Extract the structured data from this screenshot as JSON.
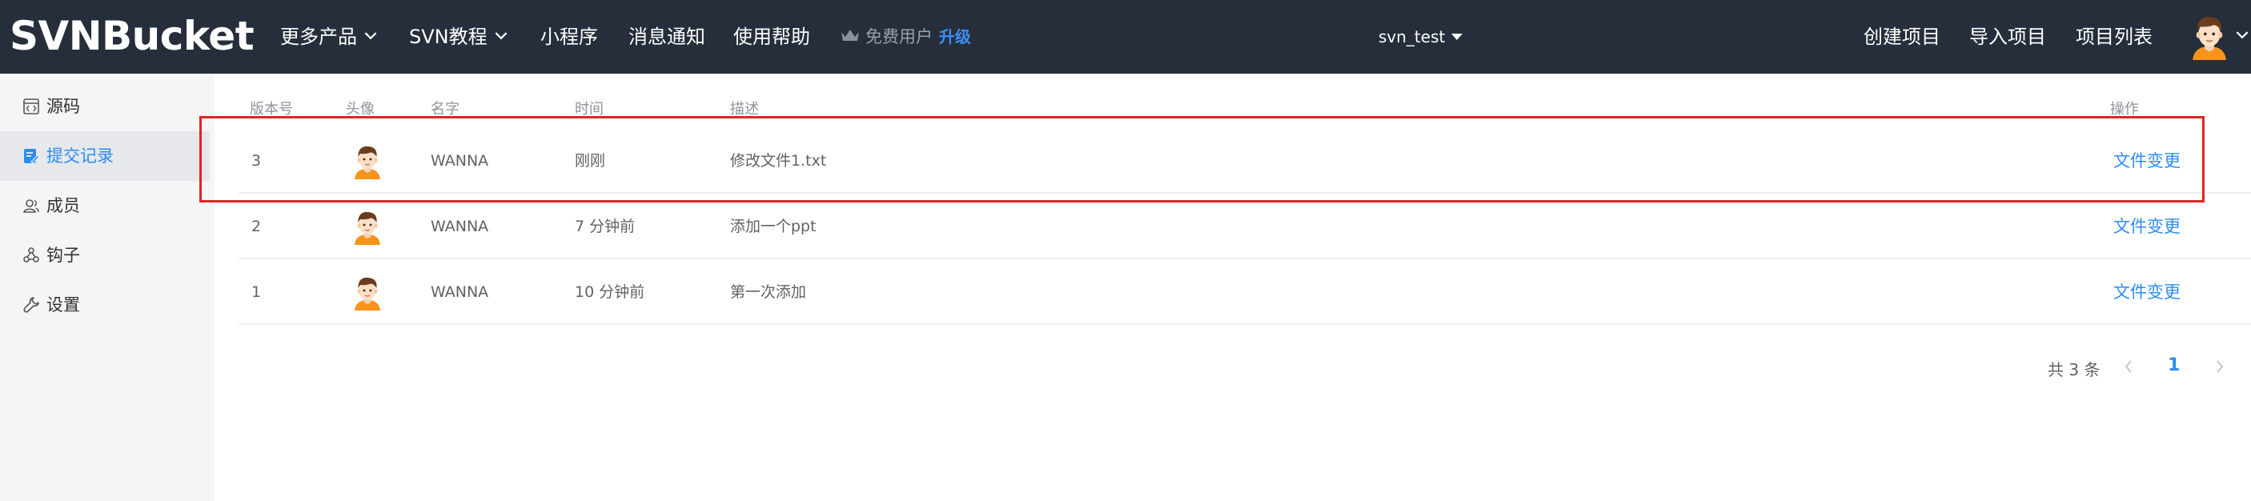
{
  "header": {
    "logo": "SVNBucket",
    "nav": [
      {
        "label": "更多产品",
        "has_dropdown": true
      },
      {
        "label": "SVN教程",
        "has_dropdown": true
      },
      {
        "label": "小程序"
      },
      {
        "label": "消息通知"
      },
      {
        "label": "使用帮助"
      }
    ],
    "account_type": "免费用户",
    "upgrade_label": "升级",
    "repo_name": "svn_test",
    "actions": [
      "创建项目",
      "导入项目",
      "项目列表"
    ],
    "icons": {
      "crown": "crown-icon",
      "avatar": "user-avatar",
      "dropdown": "chevron-down-icon"
    }
  },
  "sidebar": {
    "items": [
      {
        "label": "源码",
        "icon": "code-icon"
      },
      {
        "label": "提交记录",
        "icon": "commit-log-icon",
        "active": true
      },
      {
        "label": "成员",
        "icon": "members-icon"
      },
      {
        "label": "钩子",
        "icon": "webhook-icon"
      },
      {
        "label": "设置",
        "icon": "wrench-icon"
      }
    ]
  },
  "table": {
    "headers": {
      "revision": "版本号",
      "avatar": "头像",
      "name": "名字",
      "time": "时间",
      "description": "描述",
      "action": "操作"
    },
    "rows": [
      {
        "revision": "3",
        "name": "WANNA",
        "time": "刚刚",
        "description": "修改文件1.txt",
        "action": "文件变更",
        "highlighted": true
      },
      {
        "revision": "2",
        "name": "WANNA",
        "time": "7 分钟前",
        "description": "添加一个ppt",
        "action": "文件变更"
      },
      {
        "revision": "1",
        "name": "WANNA",
        "time": "10 分钟前",
        "description": "第一次添加",
        "action": "文件变更"
      }
    ]
  },
  "pagination": {
    "total_label": "共 3 条",
    "current_page": "1"
  },
  "colors": {
    "header_bg": "#262e3b",
    "accent": "#2d8cf0",
    "highlight_border": "#e02424",
    "sidebar_bg": "#f5f5f6"
  }
}
